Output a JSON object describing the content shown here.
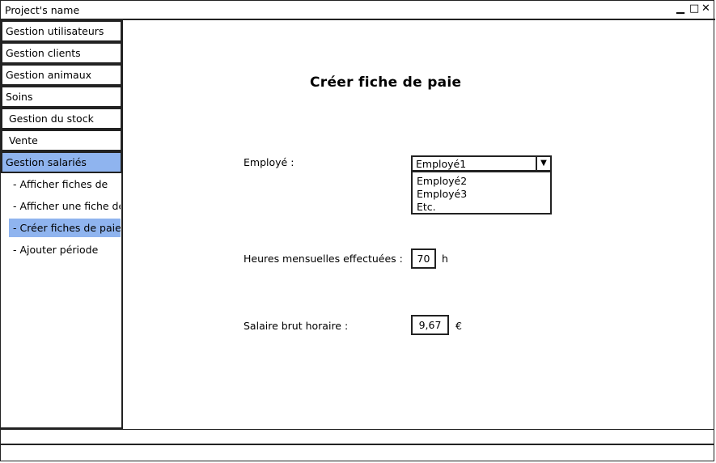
{
  "window": {
    "title": "Project's name",
    "minimize_glyph": "▁",
    "maximize_glyph": "□",
    "close_glyph": "✕"
  },
  "sidebar": {
    "items": [
      {
        "label": "Gestion utilisateurs"
      },
      {
        "label": "Gestion clients"
      },
      {
        "label": "Gestion animaux"
      },
      {
        "label": "Soins"
      },
      {
        "label": "Gestion du stock"
      },
      {
        "label": "Vente"
      },
      {
        "label": "Gestion salariés"
      }
    ],
    "subitems": [
      {
        "label": "- Afficher fiches de"
      },
      {
        "label": "- Afficher une fiche de"
      },
      {
        "label": "- Créer fiches de paie"
      },
      {
        "label": "- Ajouter période"
      }
    ],
    "active_color": "#8fb4ef"
  },
  "main": {
    "heading": "Créer fiche de paie",
    "employee": {
      "label": "Employé :",
      "selected": "Employé1",
      "dropdown_icon": "triangle-down-icon",
      "options": [
        "Employé2",
        "Employé3",
        "Etc."
      ]
    },
    "hours": {
      "label": "Heures mensuelles effectuées :",
      "value": "70",
      "unit": "h"
    },
    "salary": {
      "label": "Salaire brut horaire :",
      "value": "9,67",
      "unit": "€"
    }
  }
}
